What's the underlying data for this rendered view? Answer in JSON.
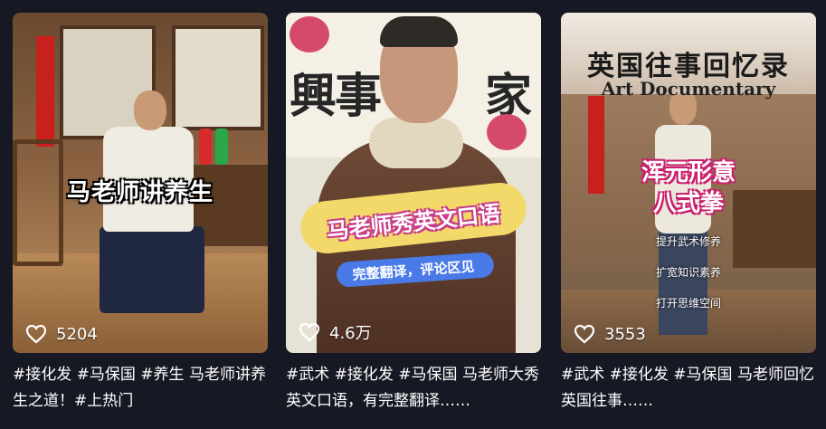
{
  "colors": {
    "background": "#161823",
    "text": "#ffffff"
  },
  "icons": {
    "like": "heart-outline-icon"
  },
  "videos": [
    {
      "overlay_text": [
        "马老师讲养生"
      ],
      "likes": "5204",
      "title": "#接化发 #马保国 #养生 马老师讲养生之道！#上热门"
    },
    {
      "overlay_text": [
        "马老师秀英文口语",
        "完整翻译，评论区见"
      ],
      "background_text": [
        "興",
        "事",
        "家"
      ],
      "likes": "4.6万",
      "title": "#武术 #接化发 #马保国 马老师大秀英文口语，有完整翻译……"
    },
    {
      "overlay_text": [
        "英国往事回忆录",
        "Art Documentary",
        "浑元形意",
        "八式拳",
        "提升武术修养",
        "扩宽知识素养",
        "打开思维空间"
      ],
      "likes": "3553",
      "title": "#武术 #接化发 #马保国 马老师回忆英国往事……"
    }
  ]
}
